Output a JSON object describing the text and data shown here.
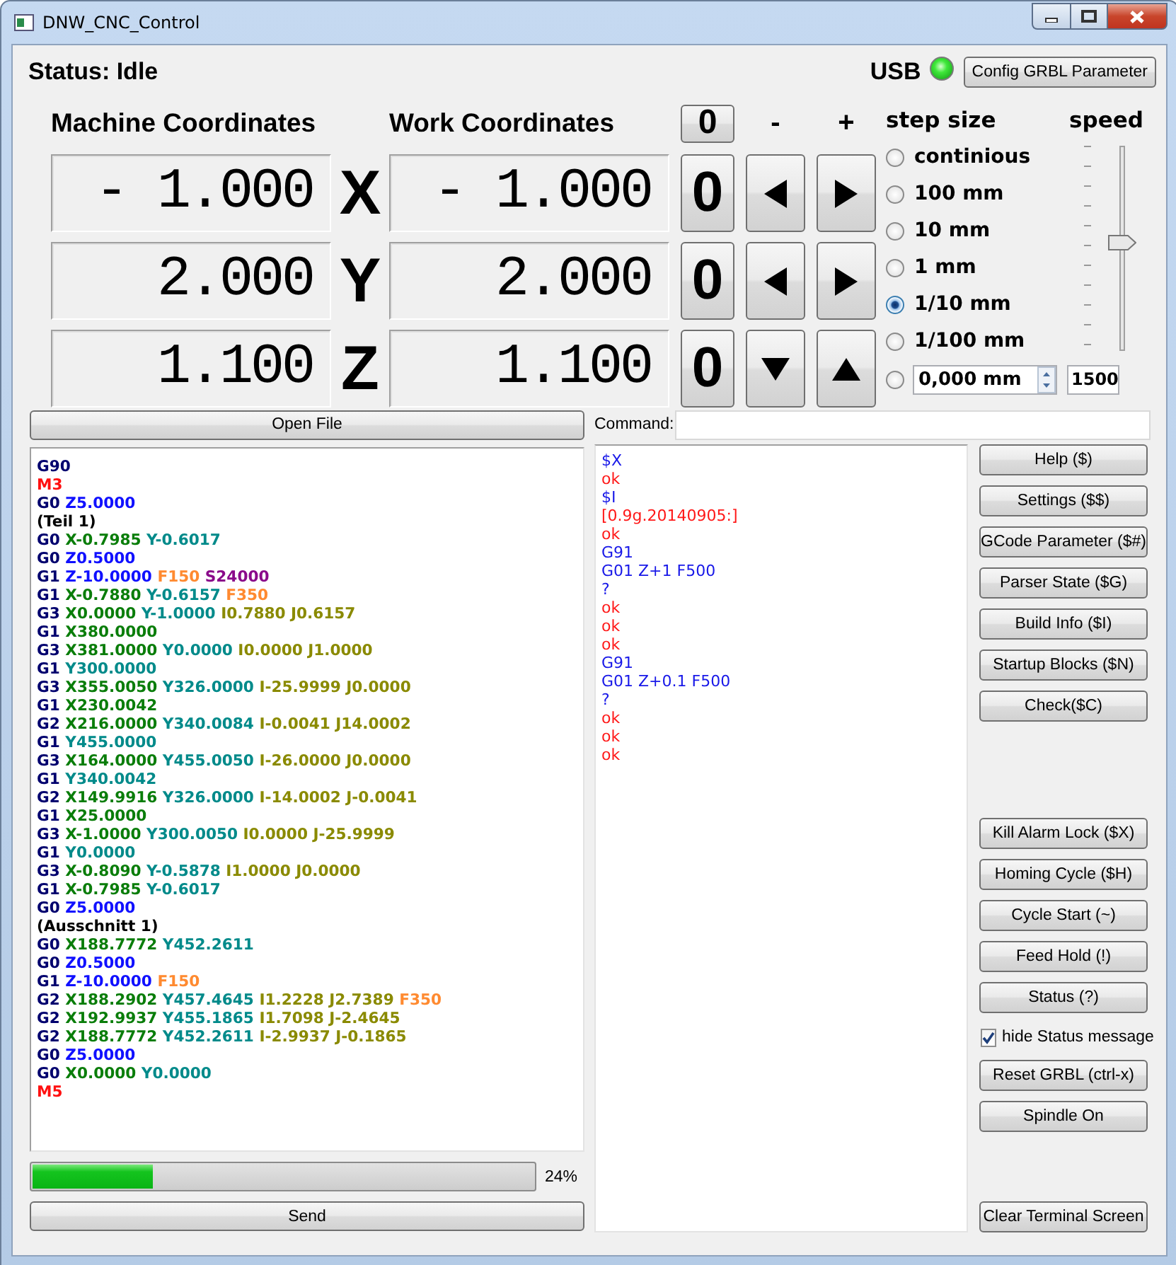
{
  "window": {
    "title": "DNW_CNC_Control"
  },
  "status": {
    "label": "Status: Idle"
  },
  "connection": {
    "label": "USB",
    "connected": true
  },
  "config_button": "Config GRBL Parameter",
  "coordinates": {
    "machine_heading": "Machine Coordinates",
    "work_heading": "Work Coordinates",
    "zero_all": "0",
    "minus": "-",
    "plus": "+",
    "axes": [
      {
        "axis": "X",
        "machine": "- 1.000",
        "work": "- 1.000",
        "zero": "0",
        "kind": "horizontal"
      },
      {
        "axis": "Y",
        "machine": "2.000",
        "work": "2.000",
        "zero": "0",
        "kind": "horizontal"
      },
      {
        "axis": "Z",
        "machine": "1.100",
        "work": "1.100",
        "zero": "0",
        "kind": "vertical"
      }
    ]
  },
  "step_size": {
    "heading": "step size",
    "options": [
      {
        "kind": "preset",
        "label": "continious",
        "selected": false
      },
      {
        "kind": "preset",
        "label": "100 mm",
        "selected": false
      },
      {
        "kind": "preset",
        "label": "10 mm",
        "selected": false
      },
      {
        "kind": "preset",
        "label": "1 mm",
        "selected": false
      },
      {
        "kind": "preset",
        "label": "1/10 mm",
        "selected": true
      },
      {
        "kind": "preset",
        "label": "1/100 mm",
        "selected": false
      },
      {
        "kind": "custom",
        "value": "0,000 mm",
        "selected": false
      }
    ]
  },
  "speed": {
    "heading": "speed",
    "level": 0.53,
    "value": "1500"
  },
  "open_file": "Open File",
  "command": {
    "label": "Command:"
  },
  "gcode": {
    "lines": [
      [
        {
          "text": "G90",
          "kind": "g"
        }
      ],
      [
        {
          "text": "M3",
          "kind": "m"
        }
      ],
      [
        {
          "text": "G0",
          "kind": "g"
        },
        {
          "text": "Z5.0000",
          "kind": "z"
        }
      ],
      [
        {
          "text": "(Teil 1)",
          "kind": "comment"
        }
      ],
      [
        {
          "text": "G0",
          "kind": "g"
        },
        {
          "text": "X-0.7985",
          "kind": "x"
        },
        {
          "text": "Y-0.6017",
          "kind": "y"
        }
      ],
      [
        {
          "text": "G0",
          "kind": "g"
        },
        {
          "text": "Z0.5000",
          "kind": "z"
        }
      ],
      [
        {
          "text": "G1",
          "kind": "g"
        },
        {
          "text": "Z-10.0000",
          "kind": "z"
        },
        {
          "text": "F150",
          "kind": "f"
        },
        {
          "text": "S24000",
          "kind": "s"
        }
      ],
      [
        {
          "text": "G1",
          "kind": "g"
        },
        {
          "text": "X-0.7880",
          "kind": "x"
        },
        {
          "text": "Y-0.6157",
          "kind": "y"
        },
        {
          "text": "F350",
          "kind": "f"
        }
      ],
      [
        {
          "text": "G3",
          "kind": "g"
        },
        {
          "text": "X0.0000",
          "kind": "x"
        },
        {
          "text": "Y-1.0000",
          "kind": "y"
        },
        {
          "text": "I0.7880",
          "kind": "ij"
        },
        {
          "text": "J0.6157",
          "kind": "ij"
        }
      ],
      [
        {
          "text": "G1",
          "kind": "g"
        },
        {
          "text": "X380.0000",
          "kind": "x"
        }
      ],
      [
        {
          "text": "G3",
          "kind": "g"
        },
        {
          "text": "X381.0000",
          "kind": "x"
        },
        {
          "text": "Y0.0000",
          "kind": "y"
        },
        {
          "text": "I0.0000",
          "kind": "ij"
        },
        {
          "text": "J1.0000",
          "kind": "ij"
        }
      ],
      [
        {
          "text": "G1",
          "kind": "g"
        },
        {
          "text": "Y300.0000",
          "kind": "y"
        }
      ],
      [
        {
          "text": "G3",
          "kind": "g"
        },
        {
          "text": "X355.0050",
          "kind": "x"
        },
        {
          "text": "Y326.0000",
          "kind": "y"
        },
        {
          "text": "I-25.9999",
          "kind": "ij"
        },
        {
          "text": "J0.0000",
          "kind": "ij"
        }
      ],
      [
        {
          "text": "G1",
          "kind": "g"
        },
        {
          "text": "X230.0042",
          "kind": "x"
        }
      ],
      [
        {
          "text": "G2",
          "kind": "g"
        },
        {
          "text": "X216.0000",
          "kind": "x"
        },
        {
          "text": "Y340.0084",
          "kind": "y"
        },
        {
          "text": "I-0.0041",
          "kind": "ij"
        },
        {
          "text": "J14.0002",
          "kind": "ij"
        }
      ],
      [
        {
          "text": "G1",
          "kind": "g"
        },
        {
          "text": "Y455.0000",
          "kind": "y"
        }
      ],
      [
        {
          "text": "G3",
          "kind": "g"
        },
        {
          "text": "X164.0000",
          "kind": "x"
        },
        {
          "text": "Y455.0050",
          "kind": "y"
        },
        {
          "text": "I-26.0000",
          "kind": "ij"
        },
        {
          "text": "J0.0000",
          "kind": "ij"
        }
      ],
      [
        {
          "text": "G1",
          "kind": "g"
        },
        {
          "text": "Y340.0042",
          "kind": "y"
        }
      ],
      [
        {
          "text": "G2",
          "kind": "g"
        },
        {
          "text": "X149.9916",
          "kind": "x"
        },
        {
          "text": "Y326.0000",
          "kind": "y"
        },
        {
          "text": "I-14.0002",
          "kind": "ij"
        },
        {
          "text": "J-0.0041",
          "kind": "ij"
        }
      ],
      [
        {
          "text": "G1",
          "kind": "g"
        },
        {
          "text": "X25.0000",
          "kind": "x"
        }
      ],
      [
        {
          "text": "G3",
          "kind": "g"
        },
        {
          "text": "X-1.0000",
          "kind": "x"
        },
        {
          "text": "Y300.0050",
          "kind": "y"
        },
        {
          "text": "I0.0000",
          "kind": "ij"
        },
        {
          "text": "J-25.9999",
          "kind": "ij"
        }
      ],
      [
        {
          "text": "G1",
          "kind": "g"
        },
        {
          "text": "Y0.0000",
          "kind": "y"
        }
      ],
      [
        {
          "text": "G3",
          "kind": "g"
        },
        {
          "text": "X-0.8090",
          "kind": "x"
        },
        {
          "text": "Y-0.5878",
          "kind": "y"
        },
        {
          "text": "I1.0000",
          "kind": "ij"
        },
        {
          "text": "J0.0000",
          "kind": "ij"
        }
      ],
      [
        {
          "text": "G1",
          "kind": "g"
        },
        {
          "text": "X-0.7985",
          "kind": "x"
        },
        {
          "text": "Y-0.6017",
          "kind": "y"
        }
      ],
      [
        {
          "text": "G0",
          "kind": "g"
        },
        {
          "text": "Z5.0000",
          "kind": "z"
        }
      ],
      [
        {
          "text": "(Ausschnitt 1)",
          "kind": "comment"
        }
      ],
      [
        {
          "text": "G0",
          "kind": "g"
        },
        {
          "text": "X188.7772",
          "kind": "x"
        },
        {
          "text": "Y452.2611",
          "kind": "y"
        }
      ],
      [
        {
          "text": "G0",
          "kind": "g"
        },
        {
          "text": "Z0.5000",
          "kind": "z"
        }
      ],
      [
        {
          "text": "G1",
          "kind": "g"
        },
        {
          "text": "Z-10.0000",
          "kind": "z"
        },
        {
          "text": "F150",
          "kind": "f"
        }
      ],
      [
        {
          "text": "G2",
          "kind": "g"
        },
        {
          "text": "X188.2902",
          "kind": "x"
        },
        {
          "text": "Y457.4645",
          "kind": "y"
        },
        {
          "text": "I1.2228",
          "kind": "ij"
        },
        {
          "text": "J2.7389",
          "kind": "ij"
        },
        {
          "text": "F350",
          "kind": "f"
        }
      ],
      [
        {
          "text": "G2",
          "kind": "g"
        },
        {
          "text": "X192.9937",
          "kind": "x"
        },
        {
          "text": "Y455.1865",
          "kind": "y"
        },
        {
          "text": "I1.7098",
          "kind": "ij"
        },
        {
          "text": "J-2.4645",
          "kind": "ij"
        }
      ],
      [
        {
          "text": "G2",
          "kind": "g"
        },
        {
          "text": "X188.7772",
          "kind": "x"
        },
        {
          "text": "Y452.2611",
          "kind": "y"
        },
        {
          "text": "I-2.9937",
          "kind": "ij"
        },
        {
          "text": "J-0.1865",
          "kind": "ij"
        }
      ],
      [
        {
          "text": "G0",
          "kind": "g"
        },
        {
          "text": "Z5.0000",
          "kind": "z"
        }
      ],
      [
        {
          "text": "G0",
          "kind": "g"
        },
        {
          "text": "X0.0000",
          "kind": "x"
        },
        {
          "text": "Y0.0000",
          "kind": "y"
        }
      ],
      [
        {
          "text": "M5",
          "kind": "m"
        }
      ]
    ]
  },
  "progress": {
    "level": 0.24,
    "reading": "24%"
  },
  "send": "Send",
  "terminal": {
    "lines": [
      {
        "text": "$X",
        "kind": "sent"
      },
      {
        "text": "ok",
        "kind": "received"
      },
      {
        "text": "$I",
        "kind": "sent"
      },
      {
        "text": "[0.9g.20140905:]",
        "kind": "received"
      },
      {
        "text": "ok",
        "kind": "received"
      },
      {
        "text": "G91",
        "kind": "sent"
      },
      {
        "text": "G01 Z+1 F500",
        "kind": "sent"
      },
      {
        "text": "?",
        "kind": "sent"
      },
      {
        "text": "ok",
        "kind": "received"
      },
      {
        "text": "ok",
        "kind": "received"
      },
      {
        "text": "ok",
        "kind": "received"
      },
      {
        "text": "G91",
        "kind": "sent"
      },
      {
        "text": "G01 Z+0.1 F500",
        "kind": "sent"
      },
      {
        "text": "?",
        "kind": "sent"
      },
      {
        "text": "ok",
        "kind": "received"
      },
      {
        "text": "ok",
        "kind": "received"
      },
      {
        "text": "ok",
        "kind": "received"
      }
    ]
  },
  "commands": {
    "top": [
      {
        "kind": "button",
        "label": "Help ($)"
      },
      {
        "kind": "button",
        "label": "Settings ($$)"
      },
      {
        "kind": "button",
        "label": "GCode Parameter ($#)"
      },
      {
        "kind": "button",
        "label": "Parser State ($G)"
      },
      {
        "kind": "button",
        "label": "Build Info ($I)"
      },
      {
        "kind": "button",
        "label": "Startup Blocks ($N)"
      },
      {
        "kind": "button",
        "label": "Check($C)"
      }
    ],
    "bottom": [
      {
        "kind": "button",
        "label": "Kill Alarm Lock ($X)"
      },
      {
        "kind": "button",
        "label": "Homing Cycle ($H)"
      },
      {
        "kind": "button",
        "label": "Cycle Start (~)"
      },
      {
        "kind": "button",
        "label": "Feed Hold (!)"
      },
      {
        "kind": "button",
        "label": "Status (?)"
      },
      {
        "kind": "checkbox",
        "label": "hide Status message",
        "checked": true
      },
      {
        "kind": "button",
        "label": "Reset GRBL (ctrl-x)"
      },
      {
        "kind": "button",
        "label": "Spindle On"
      }
    ],
    "clear": "Clear Terminal Screen"
  }
}
